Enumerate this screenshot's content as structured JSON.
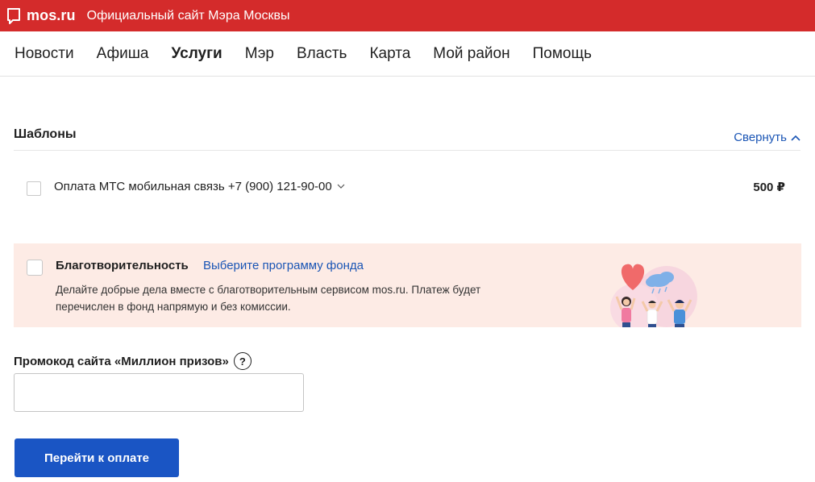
{
  "header": {
    "logo_text": "mos.ru",
    "site_title": "Официальный сайт Мэра Москвы",
    "brand_color": "#d42b2b"
  },
  "nav": {
    "items": [
      {
        "label": "Новости",
        "active": false
      },
      {
        "label": "Афиша",
        "active": false
      },
      {
        "label": "Услуги",
        "active": true
      },
      {
        "label": "Мэр",
        "active": false
      },
      {
        "label": "Власть",
        "active": false
      },
      {
        "label": "Карта",
        "active": false
      },
      {
        "label": "Мой район",
        "active": false
      },
      {
        "label": "Помощь",
        "active": false
      }
    ]
  },
  "templates": {
    "title": "Шаблоны",
    "collapse_label": "Свернуть",
    "items": [
      {
        "label": "Оплата МТС мобильная связь +7 (900) 121-90-00",
        "amount": "500 ₽",
        "checked": false
      }
    ]
  },
  "charity": {
    "title": "Благотворительность",
    "link": "Выберите программу фонда",
    "description": "Делайте добрые дела вместе с благотворительным сервисом mos.ru. Платеж будет перечислен в фонд напрямую и без комиссии.",
    "background": "#fdebe5",
    "checked": false
  },
  "promo": {
    "label": "Промокод сайта «Миллион призов»",
    "help": "?",
    "value": "",
    "placeholder": ""
  },
  "actions": {
    "pay_label": "Перейти к оплате",
    "accent": "#1a55c4"
  }
}
